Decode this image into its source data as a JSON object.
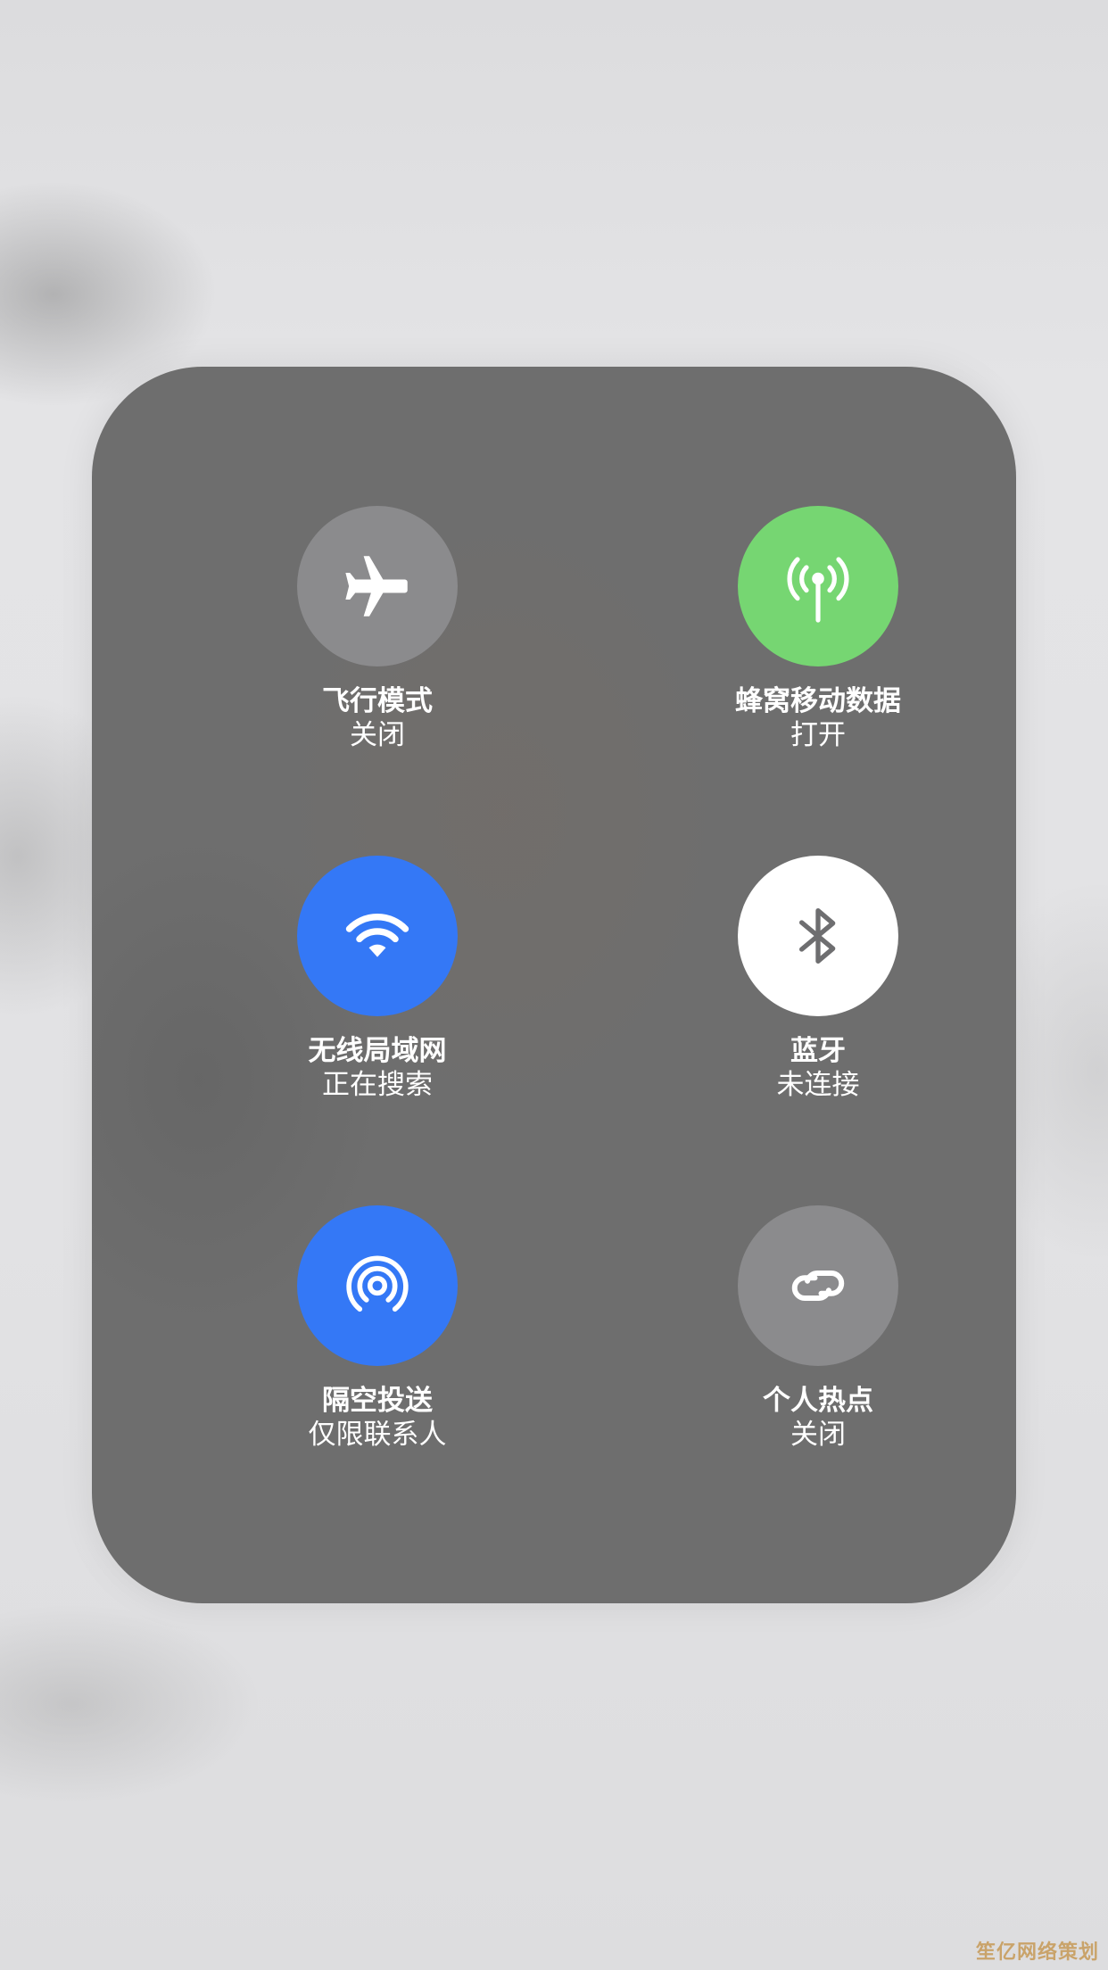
{
  "panel": {
    "tiles": [
      {
        "id": "airplane",
        "icon": "airplane-icon",
        "title": "飞行模式",
        "status": "关闭",
        "state_color": "#8b8b8d"
      },
      {
        "id": "cellular",
        "icon": "antenna-icon",
        "title": "蜂窝移动数据",
        "status": "打开",
        "state_color": "#76d672"
      },
      {
        "id": "wifi",
        "icon": "wifi-icon",
        "title": "无线局域网",
        "status": "正在搜索",
        "state_color": "#3478f6"
      },
      {
        "id": "bluetooth",
        "icon": "bluetooth-icon",
        "title": "蓝牙",
        "status": "未连接",
        "state_color": "#ffffff"
      },
      {
        "id": "airdrop",
        "icon": "airdrop-icon",
        "title": "隔空投送",
        "status": "仅限联系人",
        "state_color": "#3478f6"
      },
      {
        "id": "hotspot",
        "icon": "hotspot-link-icon",
        "title": "个人热点",
        "status": "关闭",
        "state_color": "#8b8b8d"
      }
    ]
  },
  "watermark": "笙亿网络策划"
}
